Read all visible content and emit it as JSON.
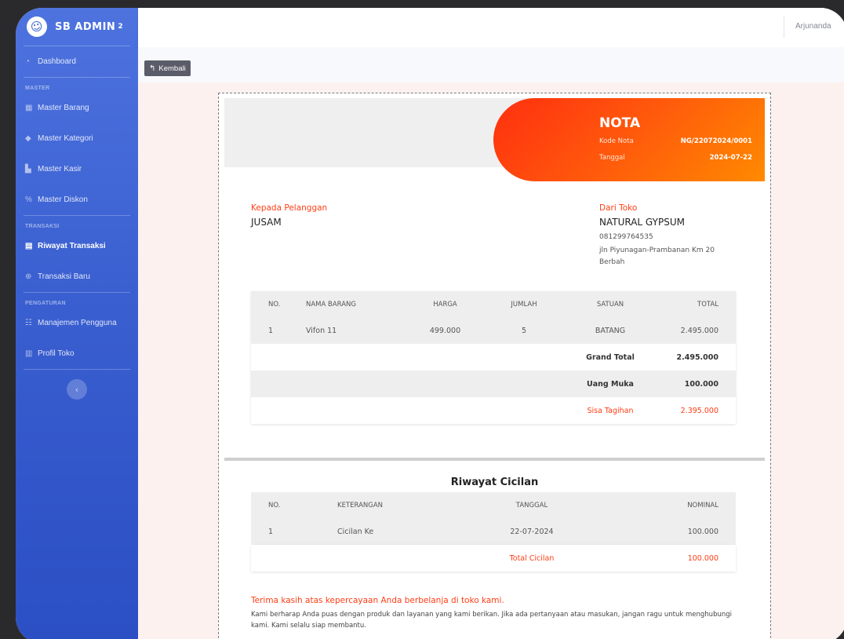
{
  "brand": {
    "name": "SB ADMIN",
    "sup": "2",
    "icon": "laugh-wink-icon"
  },
  "sidebar": {
    "dashboard": "Dashboard",
    "heading_master": "MASTER",
    "master": [
      "Master Barang",
      "Master Kategori",
      "Master Kasir",
      "Master Diskon"
    ],
    "heading_transaksi": "TRANSAKSI",
    "transaksi": [
      "Riwayat Transaksi",
      "Transaksi Baru"
    ],
    "heading_pengaturan": "PENGATURAN",
    "pengaturan": [
      "Manajemen Pengguna",
      "Profil Toko"
    ],
    "active_item": "Riwayat Transaksi"
  },
  "topbar": {
    "user": "Arjunanda"
  },
  "back_button": {
    "label": "Kembali"
  },
  "nota": {
    "title": "NOTA",
    "kode_label": "Kode Nota",
    "kode_value": "NG/22072024/0001",
    "tanggal_label": "Tanggal",
    "tanggal_value": "2024-07-22"
  },
  "customer": {
    "label": "Kepada Pelanggan",
    "name": "JUSAM"
  },
  "store": {
    "label": "Dari Toko",
    "name": "NATURAL GYPSUM",
    "phone": "081299764535",
    "address_line1": "jln Piyunagan-Prambanan Km 20",
    "address_line2": "Berbah"
  },
  "items_table": {
    "headers": {
      "no": "NO.",
      "nama": "NAMA BARANG",
      "harga": "HARGA",
      "jumlah": "JUMLAH",
      "satuan": "SATUAN",
      "total": "TOTAL"
    },
    "rows": [
      {
        "no": "1",
        "nama": "Vifon 11",
        "harga": "499.000",
        "jumlah": "5",
        "satuan": "BATANG",
        "total": "2.495.000"
      }
    ],
    "grand_total_label": "Grand Total",
    "grand_total_value": "2.495.000",
    "uang_muka_label": "Uang Muka",
    "uang_muka_value": "100.000",
    "sisa_label": "Sisa Tagihan",
    "sisa_value": "2.395.000"
  },
  "cicilan": {
    "title": "Riwayat Cicilan",
    "headers": {
      "no": "NO.",
      "keterangan": "KETERANGAN",
      "tanggal": "TANGGAL",
      "nominal": "NOMINAL"
    },
    "rows": [
      {
        "no": "1",
        "keterangan": "Cicilan Ke",
        "tanggal": "22-07-2024",
        "nominal": "100.000"
      }
    ],
    "total_label": "Total Cicilan",
    "total_value": "100.000"
  },
  "thanks": {
    "title": "Terima kasih atas kepercayaan Anda berbelanja di toko kami.",
    "body": "Kami berharap Anda puas dengan produk dan layanan yang kami berikan. Jika ada pertanyaan atau masukan, jangan ragu untuk menghubungi kami. Kami selalu siap membantu."
  },
  "colors": {
    "sidebar": "#4e73df",
    "accent_red": "#ff3d14",
    "orange": "#ff8a00"
  }
}
